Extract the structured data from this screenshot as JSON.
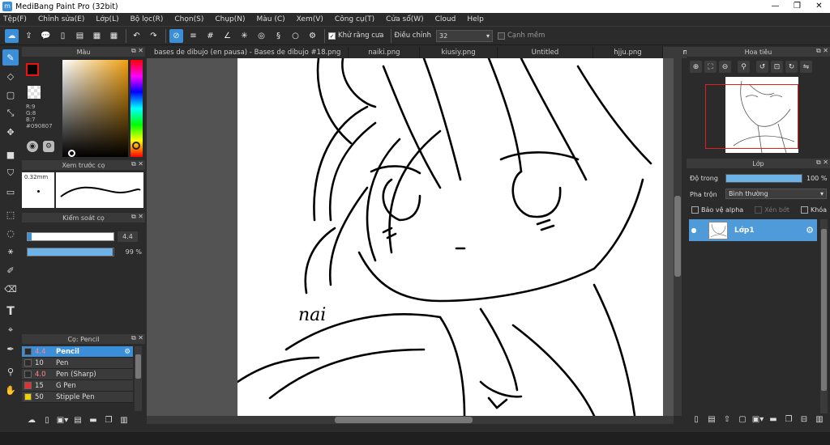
{
  "window": {
    "title": "MediBang Paint Pro (32bit)"
  },
  "menu": [
    "Tệp(F)",
    "Chỉnh sửa(E)",
    "Lớp(L)",
    "Bộ lọc(R)",
    "Chọn(S)",
    "Chụp(N)",
    "Màu (C)",
    "Xem(V)",
    "Công cụ(T)",
    "Cửa sổ(W)",
    "Cloud",
    "Help"
  ],
  "toolbar": {
    "antialias_label": "Khử răng cưa",
    "adjust_label": "Điều chỉnh",
    "adjust_value": "32",
    "edge_label": "Cạnh mềm"
  },
  "color_panel": {
    "title": "Màu",
    "r": "R:9",
    "g": "G:8",
    "b": "B:7",
    "hex": "#090807",
    "main_color": "#090807"
  },
  "brush_preview": {
    "title": "Xem trước cọ",
    "size": "0.32mm"
  },
  "brush_control": {
    "title": "Kiểm soát cọ",
    "size_value": "4.4",
    "opacity_value": "99",
    "opacity_unit": "%",
    "opacity_fraction": 0.99
  },
  "brush_list": {
    "title": "Cọ: Pencil",
    "items": [
      {
        "size": "4.4",
        "name": "Pencil",
        "color": "#2b2b2b"
      },
      {
        "size": "10",
        "name": "Pen",
        "color": "#2b2b2b"
      },
      {
        "size": "4.0",
        "name": "Pen (Sharp)",
        "color": "#2b2b2b"
      },
      {
        "size": "15",
        "name": "G Pen",
        "color": "#e53030"
      },
      {
        "size": "50",
        "name": "Stipple Pen",
        "color": "#f0d000"
      }
    ]
  },
  "tabs": [
    "bases de dibujo (en pausa) - Bases de dibujo #18.png",
    "naiki.png",
    "kiusiy.png",
    "Untitled",
    "hjju.png",
    "nai.png"
  ],
  "navigator": {
    "title": "Hoa tiêu"
  },
  "layers": {
    "title": "Lớp",
    "opacity_label": "Độ trong",
    "opacity_value": "100 %",
    "opacity_fraction": 1.0,
    "blend_label": "Pha trộn",
    "blend_value": "Bình thường",
    "protect_alpha": "Bảo vệ alpha",
    "clipping": "Xén bớt",
    "lock": "Khóa",
    "items": [
      {
        "name": "Lớp1"
      }
    ]
  },
  "canvas": {
    "signature": "nai"
  }
}
